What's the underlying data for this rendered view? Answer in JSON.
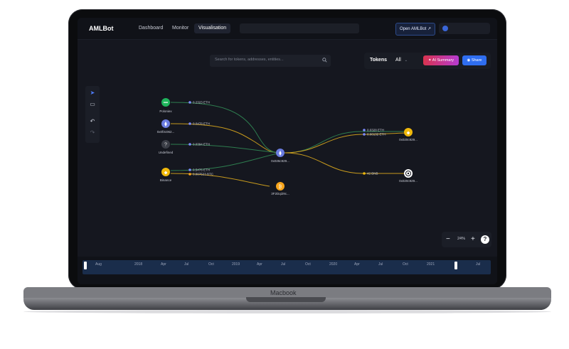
{
  "device": {
    "label": "Macbook"
  },
  "topbar": {
    "brand": "AMLBot",
    "tabs": [
      {
        "label": "Dashboard",
        "active": false
      },
      {
        "label": "Monitor",
        "active": false
      },
      {
        "label": "Visualisation",
        "active": true
      }
    ],
    "open_button": "Open AMLBot ↗"
  },
  "search": {
    "placeholder": "Search for tokens, addresses, entities..."
  },
  "filter": {
    "tokens_label": "Tokens",
    "selected": "All",
    "ai_button": "AI Summary",
    "share_button": "Share"
  },
  "graph": {
    "nodes": [
      {
        "label": "Poloniex",
        "icon": "poloniex-icon",
        "color": "#1fb45c"
      },
      {
        "label": "0x0f3c062...",
        "icon": "ethereum-icon",
        "color": "#6b7de0"
      },
      {
        "label": "Undefined",
        "icon": "question-icon",
        "color": "#3a3d46"
      },
      {
        "label": "Binance",
        "icon": "binance-icon",
        "color": "#f0b90b"
      },
      {
        "label": "0x026c929...",
        "icon": "ethereum-icon",
        "color": "#6b7de0"
      },
      {
        "label": "3F2Dqi29c...",
        "icon": "bitcoin-icon",
        "color": "#f7a51c"
      },
      {
        "label": "0x020c929...",
        "icon": "binance-icon",
        "color": "#f0b90b"
      },
      {
        "label": "0x020c929...",
        "icon": "target-icon",
        "color": "#ffffff"
      }
    ],
    "edges": [
      {
        "label": "0.2323 ETH"
      },
      {
        "label": "0.0478 ETH"
      },
      {
        "label": "0.0394 ETH"
      },
      {
        "label": "0.5476 ETH"
      },
      {
        "label": "0.007523 BTC"
      },
      {
        "label": "0.0328 ETH"
      },
      {
        "label": "0.00132 ETH"
      },
      {
        "label": "42 BNB"
      }
    ]
  },
  "zoom": {
    "minus": "−",
    "value": "24%",
    "plus": "+",
    "help": "?"
  },
  "timeline": {
    "labels": [
      "Aug",
      "2018",
      "Apr",
      "Jul",
      "Oct",
      "2019",
      "Apr",
      "Jul",
      "Oct",
      "2020",
      "Apr",
      "Jul",
      "Oct",
      "2021",
      "Jul"
    ]
  },
  "colors": {
    "accent": "#2f6ef0",
    "green_edge": "#2e7d4f",
    "yellow_edge": "#c79a1d"
  }
}
